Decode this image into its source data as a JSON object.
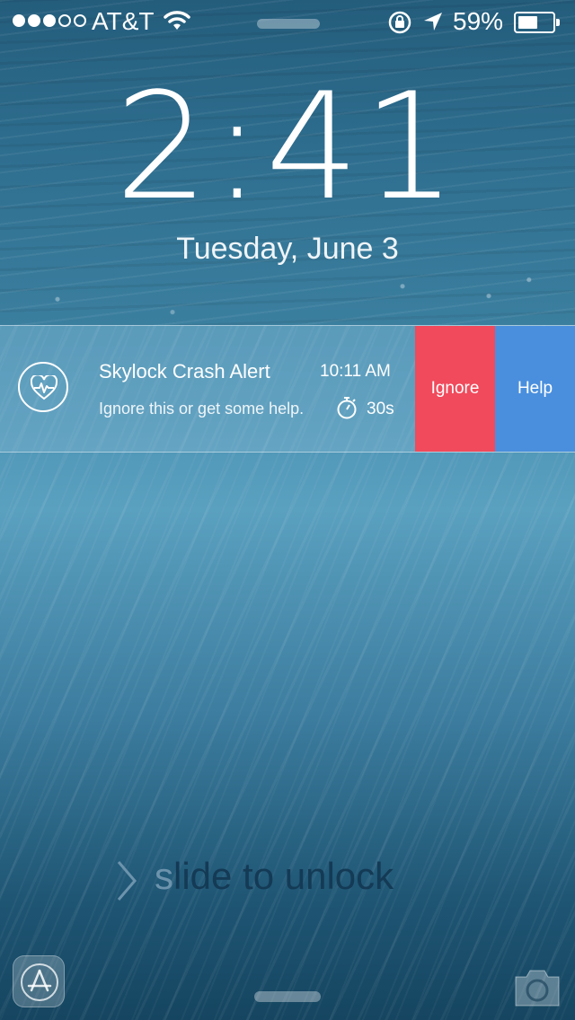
{
  "status_bar": {
    "carrier": "AT&T",
    "signal_bars_filled": 3,
    "signal_bars_total": 5,
    "battery_percent": "59%",
    "battery_level": 0.59,
    "icons": [
      "wifi-icon",
      "rotation-lock-icon",
      "location-arrow-icon",
      "battery-icon"
    ]
  },
  "lock": {
    "time": "2:41",
    "date": "Tuesday, June 3"
  },
  "notification": {
    "app_icon": "heartbeat-icon",
    "title": "Skylock Crash Alert",
    "time": "10:11 AM",
    "body": "Ignore this or get some help.",
    "countdown_icon": "stopwatch-icon",
    "countdown": "30s",
    "actions": {
      "ignore_label": "Ignore",
      "help_label": "Help"
    },
    "colors": {
      "ignore": "#f04a5c",
      "help": "#4a8fdd"
    }
  },
  "unlock": {
    "text_highlight": "s",
    "text_rest": "lide to unlock",
    "icon": "chevron-right-icon"
  },
  "bottom": {
    "left_icon": "app-store-icon",
    "right_icon": "camera-icon"
  }
}
